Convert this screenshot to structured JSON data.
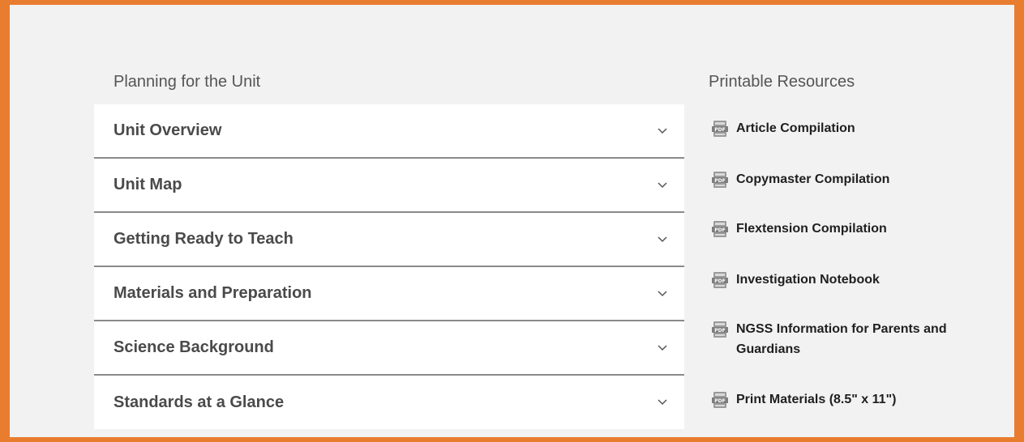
{
  "planning": {
    "heading": "Planning for the Unit",
    "items": [
      {
        "label": "Unit Overview"
      },
      {
        "label": "Unit Map"
      },
      {
        "label": "Getting Ready to Teach"
      },
      {
        "label": "Materials and Preparation"
      },
      {
        "label": "Science Background"
      },
      {
        "label": "Standards at a Glance"
      }
    ]
  },
  "resources": {
    "heading": "Printable Resources",
    "items": [
      {
        "label": "Article Compilation",
        "icon": "pdf-icon"
      },
      {
        "label": "Copymaster Compilation",
        "icon": "pdf-icon"
      },
      {
        "label": "Flextension Compilation",
        "icon": "pdf-icon"
      },
      {
        "label": "Investigation Notebook",
        "icon": "pdf-icon"
      },
      {
        "label": "NGSS Information for Parents and Guardians",
        "icon": "pdf-icon"
      },
      {
        "label": "Print Materials (8.5\" x 11\")",
        "icon": "pdf-icon"
      }
    ]
  },
  "colors": {
    "border_accent": "#e87d2f",
    "panel_bg": "#f2f2f2"
  }
}
